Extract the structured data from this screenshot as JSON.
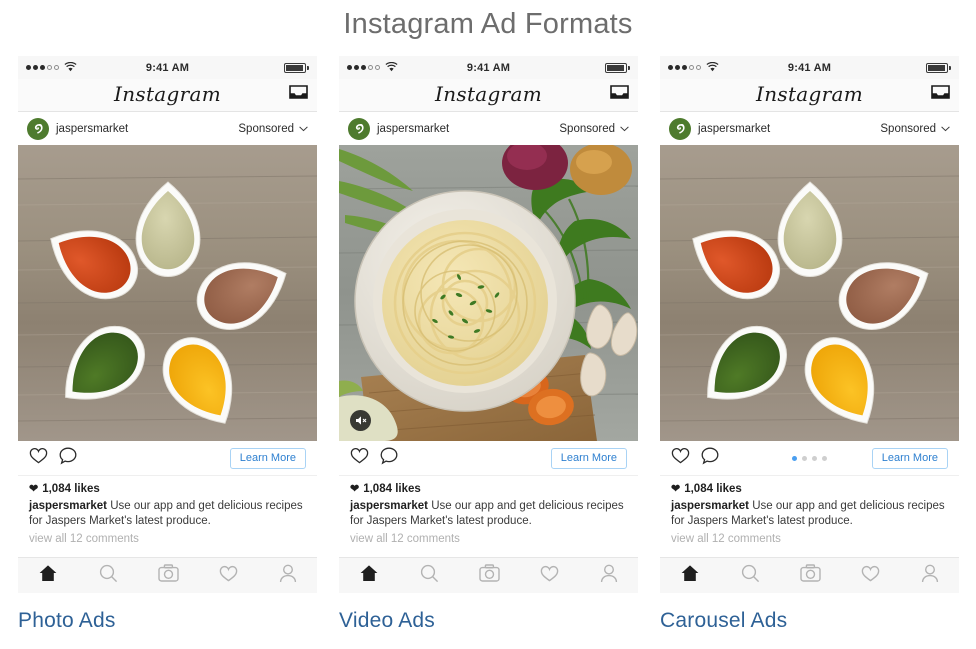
{
  "page": {
    "title": "Instagram Ad Formats"
  },
  "phone": {
    "status": {
      "time": "9:41 AM",
      "signal_filled": 3,
      "signal_hollow": 2,
      "wifi_icon": "wifi-icon",
      "battery_icon": "battery-icon"
    },
    "app_bar": {
      "wordmark": "Instagram",
      "inbox_icon": "inbox-icon"
    },
    "profile": {
      "handle": "jaspersmarket",
      "sponsored_label": "Sponsored",
      "chevron_icon": "chevron-down-icon",
      "avatar_icon": "jaspers-market-logo"
    },
    "actions": {
      "like_icon": "heart-icon",
      "comment_icon": "comment-bubble-icon",
      "cta_label": "Learn More"
    },
    "caption": {
      "likes": "1,084 likes",
      "author": "jaspersmarket",
      "text": "Use our app and get delicious recipes for Jaspers Market's latest produce.",
      "view_comments": "view all 12 comments"
    },
    "nav": {
      "home_icon": "home-icon",
      "search_icon": "search-icon",
      "camera_icon": "camera-icon",
      "activity_icon": "heart-icon",
      "profile_icon": "person-icon"
    }
  },
  "columns": [
    {
      "label": "Photo Ads",
      "media_type": "photo",
      "media_alt": "spice-bowls-photo",
      "has_sound_badge": false,
      "has_carousel_dots": false
    },
    {
      "label": "Video Ads",
      "media_type": "video",
      "media_alt": "pasta-bowl-video",
      "has_sound_badge": true,
      "sound_icon": "speaker-mute-icon",
      "has_carousel_dots": false
    },
    {
      "label": "Carousel Ads",
      "media_type": "carousel",
      "media_alt": "spice-bowls-photo",
      "has_sound_badge": false,
      "has_carousel_dots": true,
      "dots_total": 4,
      "dots_active_index": 0
    }
  ],
  "colors": {
    "title_gray": "#6d6d6d",
    "label_blue": "#2e6196",
    "cta_blue": "#2f80d0",
    "cta_border": "#a9d3f5",
    "dot_active": "#4a9ff0",
    "avatar_green": "#4e7b2e"
  }
}
